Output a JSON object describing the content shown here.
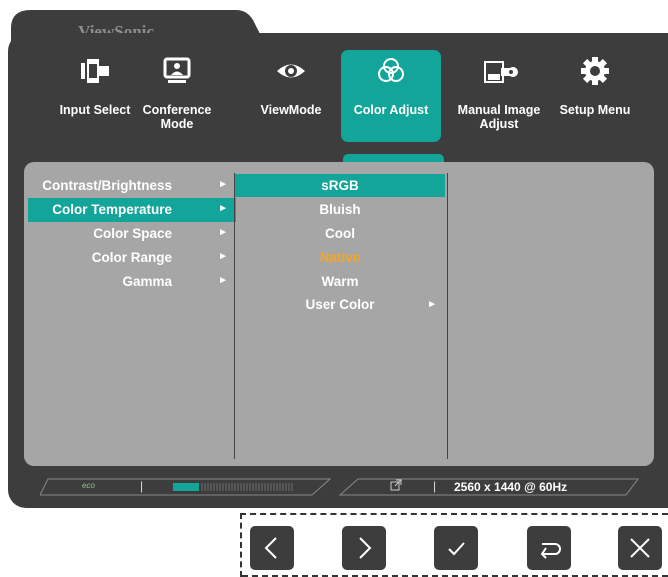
{
  "brand": "ViewSonic",
  "tabs": [
    {
      "label": "Input Select",
      "icon": "input-select-icon"
    },
    {
      "label": "Conference Mode",
      "icon": "conference-mode-icon"
    },
    {
      "label": "ViewMode",
      "icon": "eye-icon"
    },
    {
      "label": "Color Adjust",
      "icon": "color-adjust-icon",
      "active": true
    },
    {
      "label": "Manual Image Adjust",
      "icon": "manual-image-adjust-icon"
    },
    {
      "label": "Setup Menu",
      "icon": "gear-icon"
    }
  ],
  "menu": [
    {
      "label": "Contrast/Brightness",
      "arrow": "►"
    },
    {
      "label": "Color Temperature",
      "arrow": "►",
      "selected": true
    },
    {
      "label": "Color Space",
      "arrow": "►"
    },
    {
      "label": "Color Range",
      "arrow": "►"
    },
    {
      "label": "Gamma",
      "arrow": "►"
    }
  ],
  "submenu": [
    {
      "label": "sRGB",
      "selected": true
    },
    {
      "label": "Bluish"
    },
    {
      "label": "Cool"
    },
    {
      "label": "Native",
      "current": true
    },
    {
      "label": "Warm"
    },
    {
      "label": "User Color",
      "arrow": "►"
    }
  ],
  "status": {
    "eco": "eco",
    "separator": "|",
    "ext_icon": "external-link-icon",
    "resolution": "2560 x 1440 @ 60Hz"
  },
  "keys": [
    "left-key",
    "right-key",
    "ok-key",
    "return-key",
    "close-key"
  ],
  "colors": {
    "accent": "#13a59a",
    "osd_bg": "#3d3d3d",
    "panel": "#a6a6a6",
    "current": "#f5a623"
  }
}
